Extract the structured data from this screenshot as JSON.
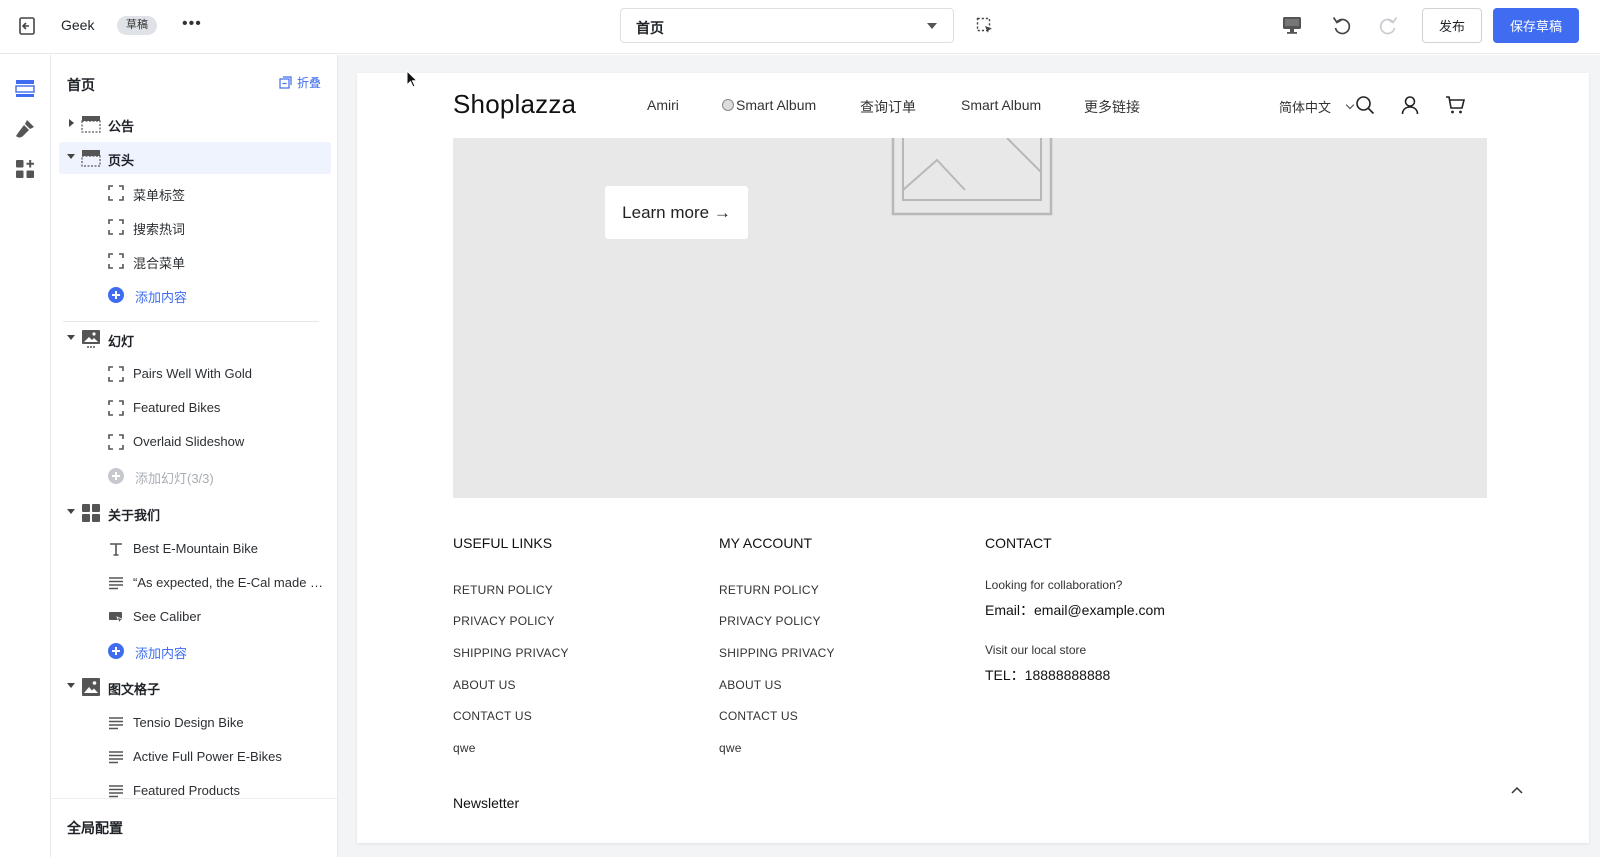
{
  "topbar": {
    "app_name": "Geek",
    "status_badge": "草稿",
    "more": "•••",
    "page_select": "首页",
    "publish_label": "发布",
    "save_draft_label": "保存草稿",
    "accent_color": "#3f6cf0"
  },
  "rail": {
    "items": [
      "sections-icon",
      "theme-style-icon",
      "apps-icon"
    ]
  },
  "sidebar": {
    "title": "首页",
    "collapse_label": "折叠",
    "sections": [
      {
        "label": "公告",
        "expanded": false,
        "icon": "announcement-icon",
        "children": []
      },
      {
        "label": "页头",
        "expanded": true,
        "active": true,
        "icon": "header-icon",
        "children": [
          "菜单标签",
          "搜索热词",
          "混合菜单"
        ],
        "add_label": "添加内容"
      },
      {
        "label": "幻灯",
        "expanded": true,
        "icon": "slideshow-icon",
        "children": [
          "Pairs Well With Gold",
          "Featured Bikes",
          "Overlaid Slideshow"
        ],
        "add_label": "添加幻灯(3/3)",
        "add_disabled": true
      },
      {
        "label": "关于我们",
        "expanded": true,
        "icon": "grid-icon",
        "children": [
          "Best E-Mountain Bike",
          "“As expected, the E-Cal made the long climbs so much easier”",
          "See Caliber"
        ],
        "add_label": "添加内容"
      },
      {
        "label": "图文格子",
        "expanded": true,
        "icon": "image-text-icon",
        "children": [
          "Tensio Design Bike",
          "Active Full Power E-Bikes",
          "Featured Products"
        ]
      }
    ],
    "footer_title": "全局配置"
  },
  "preview": {
    "logo": "Shoplazza",
    "nav": [
      "Amiri",
      "Smart Album",
      "查询订单",
      "Smart Album",
      "更多链接"
    ],
    "language": "简体中文",
    "hero_button": "Learn more →",
    "footer": {
      "useful_links": {
        "title": "USEFUL LINKS",
        "links": [
          "RETURN POLICY",
          "PRIVACY POLICY",
          "SHIPPING PRIVACY",
          "ABOUT US",
          "CONTACT US",
          "qwe"
        ]
      },
      "my_account": {
        "title": "MY ACCOUNT",
        "links": [
          "RETURN POLICY",
          "PRIVACY POLICY",
          "SHIPPING PRIVACY",
          "ABOUT US",
          "CONTACT US",
          "qwe"
        ]
      },
      "contact": {
        "title": "CONTACT",
        "question": "Looking for collaboration?",
        "email": "Email：email@example.com",
        "visit": "Visit our local store",
        "tel": "TEL：18888888888"
      },
      "newsletter": "Newsletter"
    }
  }
}
